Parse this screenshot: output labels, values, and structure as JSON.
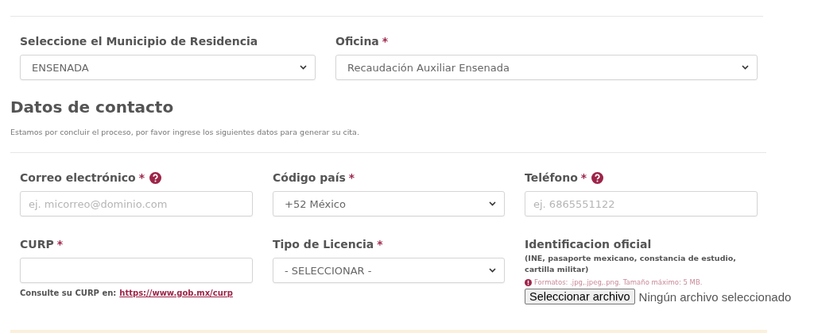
{
  "required_mark": "*",
  "top_fields": [
    {
      "label": "Seleccione el Municipio de Residencia",
      "required": false,
      "kind": "select",
      "value": "ENSENADA"
    },
    {
      "label": "Oficina",
      "required": true,
      "kind": "select",
      "value": "Recaudación Auxiliar Ensenada"
    }
  ],
  "section": {
    "title": "Datos de contacto",
    "description": "Estamos por concluir el proceso, por favor ingrese los siguientes datos para generar su cita."
  },
  "fields": [
    {
      "label": "Correo electrónico",
      "required": true,
      "help": true,
      "kind": "input",
      "placeholder": "ej. micorreo@dominio.com"
    },
    {
      "label": "Código país",
      "required": true,
      "help": false,
      "kind": "select",
      "value": "+52 México"
    },
    {
      "label": "Teléfono",
      "required": true,
      "help": true,
      "kind": "input",
      "placeholder": "ej. 6865551122"
    },
    {
      "label": "CURP",
      "required": true,
      "help": false,
      "kind": "input",
      "note": "Consulte su CURP en:",
      "link": "https://www.gob.mx/curp"
    },
    {
      "label": "Tipo de Licencia",
      "required": true,
      "help": false,
      "kind": "select",
      "value": "- SELECCIONAR -"
    },
    {
      "label": "Identificacion oficial",
      "required": false,
      "help": false,
      "kind": "file",
      "subtitle": "(INE, pasaporte mexicano, constancia de estudio, cartilla militar)",
      "info": "Formatos: .jpg,.jpeg,.png. Tamaño máximo: 5 MB.",
      "button": "Seleccionar archivo",
      "status": "Ningún archivo seleccionado"
    }
  ]
}
